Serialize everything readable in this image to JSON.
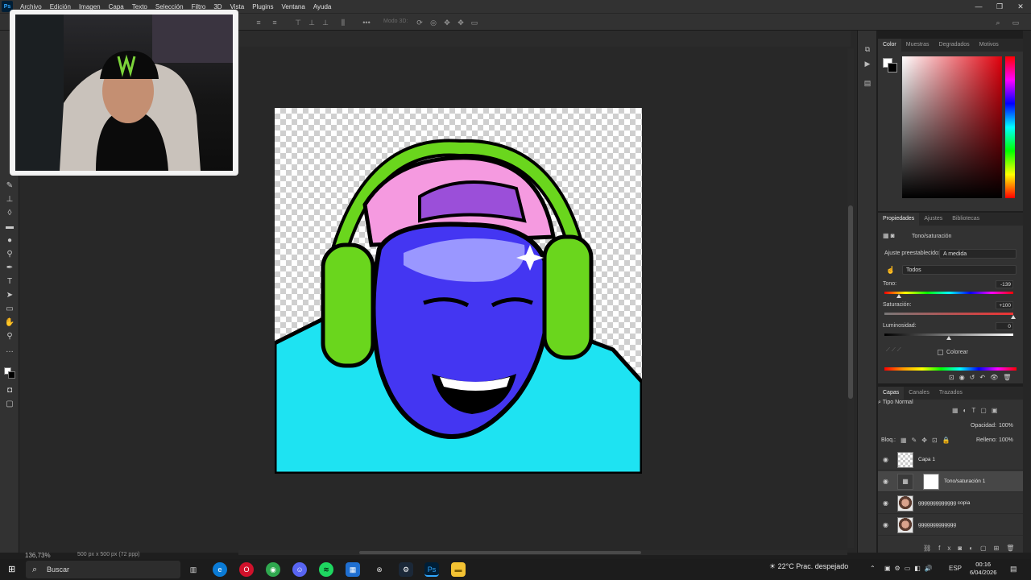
{
  "app": {
    "logo": "Ps",
    "menu": [
      "Archivo",
      "Edición",
      "Imagen",
      "Capa",
      "Texto",
      "Selección",
      "Filtro",
      "3D",
      "Vista",
      "Plugins",
      "Ventana",
      "Ayuda"
    ],
    "window_controls": [
      "—",
      "❐",
      "✕"
    ]
  },
  "options_bar": {
    "mode_3d_label": "Modo 3D:"
  },
  "status": {
    "zoom": "136,73%",
    "document_size": "500 px x 500 px (72 ppp)"
  },
  "color_panel": {
    "tabs": [
      "Color",
      "Muestras",
      "Degradados",
      "Motivos"
    ],
    "active_tab": "Color",
    "foreground": "#ffffff",
    "background": "#000000",
    "hue_color": "#e0000c"
  },
  "properties_panel": {
    "tabs": [
      "Propiedades",
      "Ajustes",
      "Bibliotecas"
    ],
    "active_tab": "Propiedades",
    "adjustment_name": "Tono/saturación",
    "preset_label": "Ajuste preestablecido:",
    "preset_value": "A medida",
    "channel_value": "Todos",
    "hue_label": "Tono:",
    "hue_value": "-139",
    "hue_level": -139,
    "saturation_label": "Saturación:",
    "saturation_value": "+100",
    "saturation_level": 100,
    "lightness_label": "Luminosidad:",
    "lightness_value": "0",
    "lightness_level": 0,
    "colorize_label": "Colorear"
  },
  "layers_panel": {
    "tabs": [
      "Capas",
      "Canales",
      "Trazados"
    ],
    "active_tab": "Capas",
    "filter_label": "Tipo",
    "blend_mode": "Normal",
    "opacity_label": "Opacidad:",
    "opacity_value": "100%",
    "lock_label": "Bloq.:",
    "fill_label": "Relleno:",
    "fill_value": "100%",
    "layers": [
      {
        "name": "Capa 1",
        "selected": false
      },
      {
        "name": "Tono/saturación 1",
        "selected": true
      },
      {
        "name": "ggggggggggggg copia",
        "selected": false
      },
      {
        "name": "ggggggggggggg",
        "selected": false
      }
    ]
  },
  "taskbar": {
    "search_placeholder": "Buscar",
    "weather": "22°C  Prac. despejado",
    "language": "ESP",
    "time": "00:16",
    "date": "6/04/2026"
  }
}
